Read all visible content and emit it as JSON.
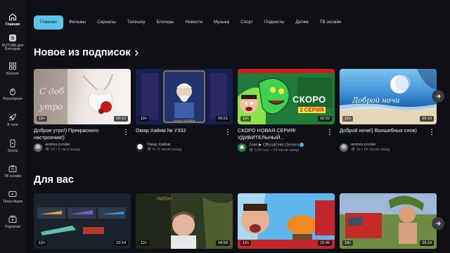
{
  "sidebar": {
    "items": [
      {
        "label": "Главная",
        "icon": "home-icon"
      },
      {
        "label": "RUTUBE для Блогеров",
        "icon": "rutube-logo-icon"
      },
      {
        "label": "Каталог",
        "icon": "grid-icon"
      },
      {
        "label": "Популярное",
        "icon": "flame-icon"
      },
      {
        "label": "В топе",
        "icon": "rocket-icon"
      },
      {
        "label": "Shorts",
        "icon": "shorts-icon"
      },
      {
        "label": "ТВ онлайн",
        "icon": "tv-icon"
      },
      {
        "label": "Трансляции",
        "icon": "broadcast-icon"
      },
      {
        "label": "Подписки",
        "icon": "subscriptions-icon"
      }
    ]
  },
  "tabs": [
    "Главная",
    "Фильмы",
    "Сериалы",
    "Телешоу",
    "Блогеры",
    "Новости",
    "Музыка",
    "Спорт",
    "Подкасты",
    "Детям",
    "ТВ онлайн"
  ],
  "sections": {
    "subs_title": "Новое из подписок",
    "for_you_title": "Для вас"
  },
  "subs_videos": [
    {
      "title": "Доброе утро!) Прекрасного настроения!)",
      "age": "12+",
      "duration": "00:12",
      "channel": "andrey.zonder",
      "views": "13",
      "time": "3 часа назад"
    },
    {
      "title": "Омар Хайям № У332",
      "age": "12+",
      "duration": "00:21",
      "channel": "Омар Хайям",
      "views": "6",
      "time": "5 часов назад"
    },
    {
      "title": "СКОРО НОВАЯ СЕРИЯ! УДИВИТЕЛЬНЫЙ...",
      "age": "12+",
      "duration": "00:22",
      "channel": "Zelel ▶ OfficialZelel (Зелел)",
      "views": "6,99 тыс.",
      "time": "14 часов назад",
      "thumb_text": [
        "СКОРО",
        "3 СЕРИЯ"
      ]
    },
    {
      "title": "Доброй ночи!) Волшебных снов)",
      "age": "12+",
      "duration": "00:10",
      "channel": "andrey.zonder",
      "views": "16",
      "time": "16 часов назад",
      "thumb_text": [
        "Доброй ночи"
      ]
    }
  ],
  "foryou_videos": [
    {
      "age": "12+",
      "duration": "10:14"
    },
    {
      "age": "12+",
      "duration": "04:59"
    },
    {
      "age": "12+",
      "duration": "15:46"
    },
    {
      "age": "18+",
      "duration": "29:19"
    }
  ],
  "colors": {
    "accent": "#5bc4e8",
    "background": "#0f1015",
    "sidebar": "#14151a"
  }
}
